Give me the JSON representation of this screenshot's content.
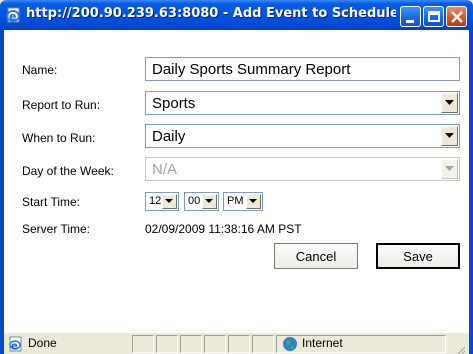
{
  "window": {
    "title": "http://200.90.239.63:8080 - Add Event to Schedule..."
  },
  "form": {
    "name_label": "Name:",
    "name_value": "Daily Sports Summary Report",
    "report_label": "Report to Run:",
    "report_value": "Sports",
    "when_label": "When to Run:",
    "when_value": "Daily",
    "day_label": "Day of the Week:",
    "day_value": "N/A",
    "start_label": "Start Time:",
    "start_hour": "12",
    "start_minute": "00",
    "start_ampm": "PM",
    "server_label": "Server Time:",
    "server_value": "02/09/2009 11:38:16 AM PST",
    "cancel_label": "Cancel",
    "save_label": "Save"
  },
  "statusbar": {
    "status_text": "Done",
    "zone_text": "Internet"
  },
  "colors": {
    "titlebar": "#0054e3",
    "window_bg": "#ffffff",
    "field_border": "#7f9db9"
  }
}
